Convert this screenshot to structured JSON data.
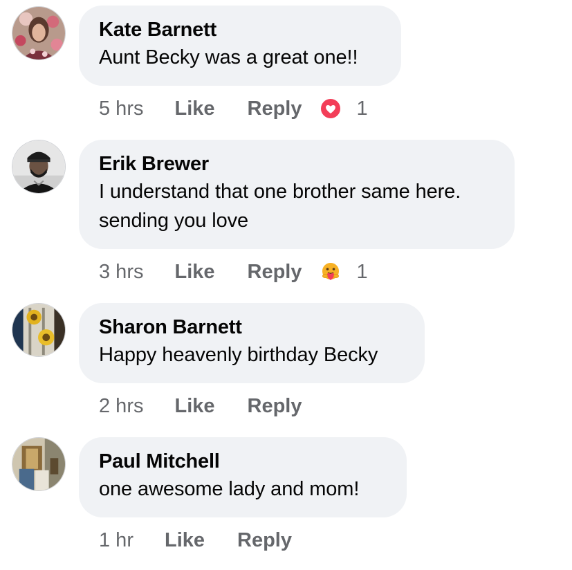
{
  "comments": [
    {
      "author": "Kate Barnett",
      "text": "Aunt Becky was a great one!!",
      "time": "5 hrs",
      "like_label": "Like",
      "reply_label": "Reply",
      "reaction": {
        "icon": "love-reaction-icon",
        "count": "1",
        "color": "#f33e58"
      }
    },
    {
      "author": "Erik Brewer",
      "text": "I understand that one brother same here. sending you love",
      "time": "3 hrs",
      "like_label": "Like",
      "reply_label": "Reply",
      "reaction": {
        "icon": "care-reaction-icon",
        "count": "1",
        "color": "#f7b125"
      }
    },
    {
      "author": "Sharon Barnett",
      "text": "Happy heavenly birthday Becky",
      "time": "2 hrs",
      "like_label": "Like",
      "reply_label": "Reply"
    },
    {
      "author": "Paul Mitchell",
      "text": "one awesome lady and mom!",
      "time": "1 hr",
      "like_label": "Like",
      "reply_label": "Reply"
    }
  ],
  "colors": {
    "bubble": "#f0f2f5",
    "text": "#050505",
    "secondary": "#65676b"
  }
}
